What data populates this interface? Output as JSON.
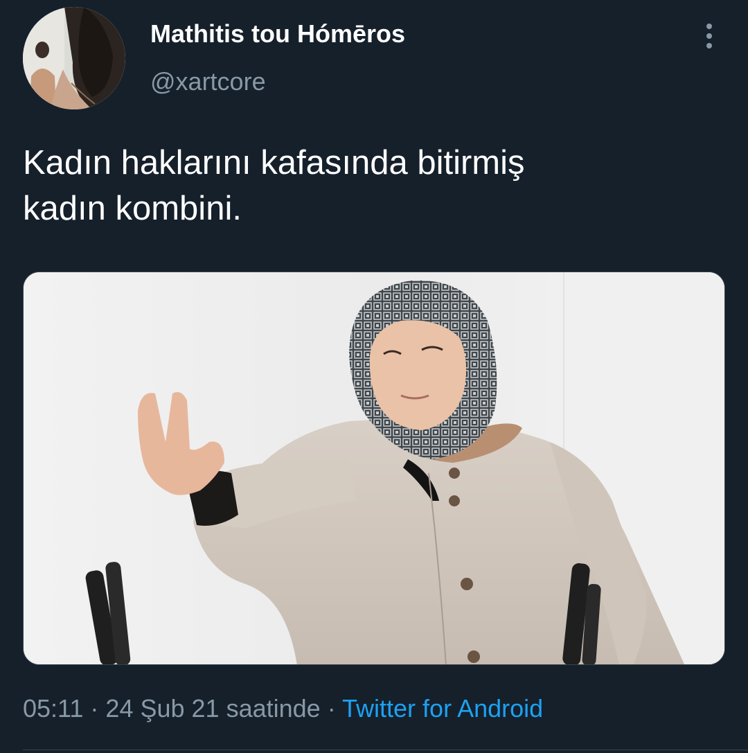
{
  "tweet": {
    "display_name": "Mathitis tou Hómēros",
    "handle": "@xartcore",
    "text": "Kadın haklarını kafasında bitirmiş\nkadın kombini.",
    "time": "05:11",
    "separator_1": " · ",
    "date": "24 Şub 21 saatinde",
    "separator_2": " · ",
    "source": "Twitter for Android"
  },
  "icons": {
    "more": "more-vertical-icon"
  },
  "colors": {
    "background": "#15202b",
    "primary_text": "#ffffff",
    "secondary_text": "#8899a6",
    "link": "#1da1f2",
    "divider": "#38444d"
  }
}
